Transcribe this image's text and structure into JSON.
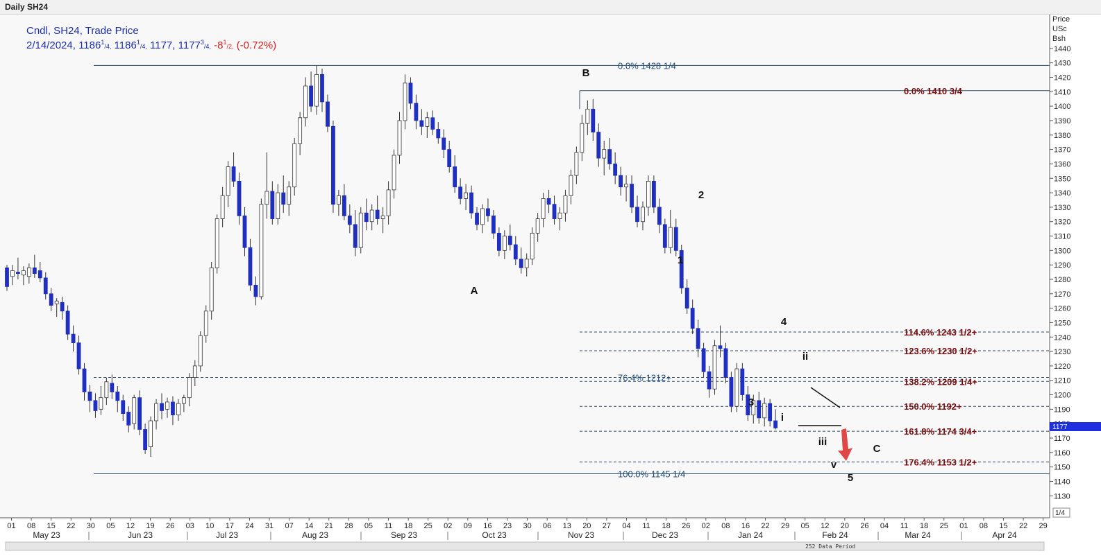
{
  "window": {
    "title": "Daily SH24"
  },
  "info": {
    "line1": "Cndl, SH24, Trade Price",
    "date": "2/14/2024,",
    "open_int": "1186",
    "open_num": "1",
    "open_den": "/4,",
    "high_int": "1186",
    "high_num": "1",
    "high_den": "/4,",
    "low": "1177,",
    "close_int": "1177",
    "close_num": "3",
    "close_den": "/4,",
    "change_int": "-8",
    "change_num": "1",
    "change_den": "/2,",
    "change_pct": "(-0.72%)"
  },
  "axis": {
    "price_header": [
      "Price",
      "USc",
      "Bsh"
    ],
    "page_indicator": "1/4",
    "data_period": "252 Data Period",
    "current_price_label": "1177"
  },
  "colors": {
    "bear_candle": "#1f2fbf",
    "bull_candle": "#ffffff",
    "candle_outline": "#333333",
    "blue_fib_text": "#1f4e79",
    "red_fib_text": "#7b0c0c",
    "fib_line": "#2a4a6b",
    "arrow": "#e04848"
  },
  "chart_data": {
    "type": "candlestick",
    "title": "Daily SH24",
    "ylabel": "Price USc Bsh",
    "ylim": [
      1125,
      1440
    ],
    "grid": false,
    "y_ticks": [
      1130,
      1140,
      1150,
      1160,
      1170,
      1180,
      1190,
      1200,
      1210,
      1220,
      1230,
      1240,
      1250,
      1260,
      1270,
      1280,
      1290,
      1300,
      1310,
      1320,
      1330,
      1340,
      1350,
      1360,
      1370,
      1380,
      1390,
      1400,
      1410,
      1420,
      1430,
      1440
    ],
    "x_day_ticks": [
      "01",
      "08",
      "15",
      "22",
      "30",
      "05",
      "12",
      "19",
      "26",
      "03",
      "10",
      "17",
      "24",
      "31",
      "07",
      "14",
      "21",
      "28",
      "05",
      "11",
      "18",
      "25",
      "02",
      "09",
      "16",
      "23",
      "30",
      "06",
      "13",
      "20",
      "27",
      "04",
      "11",
      "18",
      "26",
      "02",
      "08",
      "16",
      "22",
      "29",
      "05",
      "12",
      "20",
      "26",
      "04",
      "11",
      "18",
      "25",
      "01",
      "08",
      "15",
      "22",
      "29"
    ],
    "x_month_labels": [
      "May 23",
      "Jun 23",
      "Jul 23",
      "Aug 23",
      "Sep 23",
      "Oct 23",
      "Nov 23",
      "Dec 23",
      "Jan 24",
      "Feb 24",
      "Mar 24",
      "Apr 24"
    ],
    "candles": [
      [
        1288,
        1290,
        1272,
        1275
      ],
      [
        1282,
        1290,
        1276,
        1286
      ],
      [
        1285,
        1295,
        1280,
        1284
      ],
      [
        1283,
        1289,
        1276,
        1286
      ],
      [
        1282,
        1291,
        1277,
        1288
      ],
      [
        1288,
        1297,
        1281,
        1284
      ],
      [
        1286,
        1292,
        1278,
        1281
      ],
      [
        1281,
        1285,
        1266,
        1270
      ],
      [
        1270,
        1274,
        1258,
        1262
      ],
      [
        1263,
        1267,
        1254,
        1265
      ],
      [
        1264,
        1268,
        1252,
        1258
      ],
      [
        1258,
        1262,
        1238,
        1242
      ],
      [
        1242,
        1248,
        1230,
        1236
      ],
      [
        1236,
        1241,
        1214,
        1218
      ],
      [
        1218,
        1222,
        1196,
        1202
      ],
      [
        1202,
        1207,
        1188,
        1196
      ],
      [
        1196,
        1201,
        1184,
        1189
      ],
      [
        1190,
        1206,
        1186,
        1198
      ],
      [
        1198,
        1212,
        1193,
        1209
      ],
      [
        1208,
        1214,
        1197,
        1202
      ],
      [
        1202,
        1206,
        1188,
        1196
      ],
      [
        1196,
        1200,
        1182,
        1187
      ],
      [
        1188,
        1192,
        1174,
        1179
      ],
      [
        1180,
        1200,
        1176,
        1198
      ],
      [
        1198,
        1203,
        1172,
        1176
      ],
      [
        1176,
        1180,
        1159,
        1162
      ],
      [
        1164,
        1185,
        1157,
        1182
      ],
      [
        1182,
        1197,
        1176,
        1194
      ],
      [
        1194,
        1201,
        1183,
        1189
      ],
      [
        1190,
        1198,
        1184,
        1195
      ],
      [
        1195,
        1199,
        1179,
        1186
      ],
      [
        1186,
        1197,
        1182,
        1194
      ],
      [
        1194,
        1200,
        1188,
        1198
      ],
      [
        1198,
        1215,
        1192,
        1212
      ],
      [
        1212,
        1224,
        1206,
        1220
      ],
      [
        1220,
        1244,
        1216,
        1241
      ],
      [
        1241,
        1262,
        1236,
        1258
      ],
      [
        1258,
        1292,
        1252,
        1288
      ],
      [
        1288,
        1325,
        1284,
        1322
      ],
      [
        1322,
        1344,
        1316,
        1338
      ],
      [
        1338,
        1362,
        1330,
        1358
      ],
      [
        1358,
        1368,
        1344,
        1348
      ],
      [
        1348,
        1354,
        1318,
        1324
      ],
      [
        1324,
        1330,
        1296,
        1302
      ],
      [
        1302,
        1308,
        1272,
        1276
      ],
      [
        1276,
        1282,
        1262,
        1268
      ],
      [
        1268,
        1336,
        1266,
        1332
      ],
      [
        1332,
        1368,
        1322,
        1341
      ],
      [
        1341,
        1348,
        1318,
        1322
      ],
      [
        1322,
        1346,
        1318,
        1340
      ],
      [
        1340,
        1352,
        1326,
        1332
      ],
      [
        1332,
        1348,
        1324,
        1344
      ],
      [
        1344,
        1378,
        1338,
        1374
      ],
      [
        1374,
        1396,
        1366,
        1392
      ],
      [
        1392,
        1420,
        1386,
        1414
      ],
      [
        1414,
        1424,
        1396,
        1400
      ],
      [
        1400,
        1428,
        1394,
        1422
      ],
      [
        1422,
        1426,
        1396,
        1403
      ],
      [
        1403,
        1408,
        1382,
        1386
      ],
      [
        1386,
        1390,
        1326,
        1332
      ],
      [
        1332,
        1342,
        1324,
        1338
      ],
      [
        1338,
        1346,
        1321,
        1324
      ],
      [
        1324,
        1332,
        1312,
        1318
      ],
      [
        1318,
        1328,
        1296,
        1302
      ],
      [
        1302,
        1330,
        1298,
        1326
      ],
      [
        1326,
        1336,
        1314,
        1320
      ],
      [
        1320,
        1332,
        1314,
        1328
      ],
      [
        1328,
        1338,
        1318,
        1322
      ],
      [
        1322,
        1330,
        1312,
        1324
      ],
      [
        1324,
        1348,
        1318,
        1342
      ],
      [
        1342,
        1370,
        1336,
        1366
      ],
      [
        1366,
        1396,
        1360,
        1390
      ],
      [
        1390,
        1422,
        1384,
        1416
      ],
      [
        1416,
        1420,
        1398,
        1402
      ],
      [
        1402,
        1408,
        1384,
        1390
      ],
      [
        1390,
        1398,
        1380,
        1386
      ],
      [
        1386,
        1396,
        1378,
        1392
      ],
      [
        1392,
        1397,
        1380,
        1384
      ],
      [
        1384,
        1389,
        1374,
        1378
      ],
      [
        1378,
        1384,
        1364,
        1370
      ],
      [
        1370,
        1376,
        1354,
        1358
      ],
      [
        1358,
        1366,
        1340,
        1344
      ],
      [
        1344,
        1350,
        1332,
        1336
      ],
      [
        1336,
        1346,
        1328,
        1340
      ],
      [
        1340,
        1345,
        1322,
        1326
      ],
      [
        1326,
        1330,
        1314,
        1318
      ],
      [
        1318,
        1332,
        1312,
        1329
      ],
      [
        1329,
        1336,
        1320,
        1324
      ],
      [
        1324,
        1328,
        1308,
        1312
      ],
      [
        1312,
        1316,
        1296,
        1300
      ],
      [
        1300,
        1314,
        1294,
        1310
      ],
      [
        1310,
        1318,
        1300,
        1304
      ],
      [
        1304,
        1310,
        1290,
        1294
      ],
      [
        1294,
        1302,
        1284,
        1288
      ],
      [
        1288,
        1298,
        1282,
        1294
      ],
      [
        1294,
        1316,
        1290,
        1312
      ],
      [
        1312,
        1326,
        1306,
        1322
      ],
      [
        1322,
        1340,
        1316,
        1336
      ],
      [
        1336,
        1342,
        1326,
        1332
      ],
      [
        1332,
        1338,
        1318,
        1322
      ],
      [
        1322,
        1330,
        1314,
        1326
      ],
      [
        1326,
        1342,
        1320,
        1338
      ],
      [
        1338,
        1356,
        1332,
        1352
      ],
      [
        1352,
        1372,
        1346,
        1368
      ],
      [
        1368,
        1394,
        1362,
        1388
      ],
      [
        1388,
        1404,
        1380,
        1398
      ],
      [
        1398,
        1405,
        1376,
        1382
      ],
      [
        1382,
        1388,
        1358,
        1364
      ],
      [
        1364,
        1376,
        1352,
        1370
      ],
      [
        1370,
        1378,
        1356,
        1360
      ],
      [
        1360,
        1368,
        1346,
        1352
      ],
      [
        1352,
        1358,
        1338,
        1344
      ],
      [
        1344,
        1352,
        1334,
        1346
      ],
      [
        1346,
        1352,
        1326,
        1330
      ],
      [
        1330,
        1338,
        1316,
        1320
      ],
      [
        1320,
        1334,
        1314,
        1330
      ],
      [
        1330,
        1352,
        1324,
        1348
      ],
      [
        1348,
        1352,
        1326,
        1330
      ],
      [
        1330,
        1336,
        1312,
        1318
      ],
      [
        1318,
        1322,
        1298,
        1302
      ],
      [
        1302,
        1328,
        1298,
        1316
      ],
      [
        1316,
        1322,
        1296,
        1300
      ],
      [
        1300,
        1304,
        1270,
        1274
      ],
      [
        1274,
        1280,
        1256,
        1260
      ],
      [
        1260,
        1266,
        1242,
        1246
      ],
      [
        1246,
        1252,
        1226,
        1232
      ],
      [
        1232,
        1236,
        1212,
        1216
      ],
      [
        1216,
        1220,
        1198,
        1204
      ],
      [
        1204,
        1238,
        1200,
        1234
      ],
      [
        1234,
        1248,
        1226,
        1232
      ],
      [
        1232,
        1236,
        1208,
        1212
      ],
      [
        1212,
        1216,
        1188,
        1192
      ],
      [
        1192,
        1222,
        1188,
        1218
      ],
      [
        1218,
        1222,
        1196,
        1200
      ],
      [
        1200,
        1206,
        1182,
        1186
      ],
      [
        1186,
        1200,
        1180,
        1196
      ],
      [
        1196,
        1202,
        1180,
        1184
      ],
      [
        1184,
        1198,
        1178,
        1194
      ],
      [
        1194,
        1197,
        1178,
        1182
      ],
      [
        1182,
        1190,
        1176,
        1177
      ]
    ],
    "fib_levels": [
      {
        "label": "0.0%",
        "value_text": "1428 1/4",
        "price": 1428.25,
        "color": "blue"
      },
      {
        "label": "0.0%",
        "value_text": "1410 3/4",
        "price": 1410.75,
        "color": "red"
      },
      {
        "label": "114.6%",
        "value_text": "1243 1/2+",
        "price": 1243.5,
        "color": "red"
      },
      {
        "label": "123.6%",
        "value_text": "1230 1/2+",
        "price": 1230.5,
        "color": "red"
      },
      {
        "label": "76.4%",
        "value_text": "1212+",
        "price": 1212,
        "color": "blue"
      },
      {
        "label": "138.2%",
        "value_text": "1209 1/4+",
        "price": 1209.25,
        "color": "red"
      },
      {
        "label": "150.0%",
        "value_text": "1192+",
        "price": 1192,
        "color": "red"
      },
      {
        "label": "161.8%",
        "value_text": "1174 3/4+",
        "price": 1174.75,
        "color": "red"
      },
      {
        "label": "176.4%",
        "value_text": "1153 1/2+",
        "price": 1153.5,
        "color": "red"
      },
      {
        "label": "100.0%",
        "value_text": "1145 1/4",
        "price": 1145.25,
        "color": "blue"
      }
    ],
    "wave_labels": [
      "B",
      "A",
      "1",
      "2",
      "3",
      "4",
      "i",
      "ii",
      "iii",
      "v",
      "5",
      "C"
    ]
  }
}
